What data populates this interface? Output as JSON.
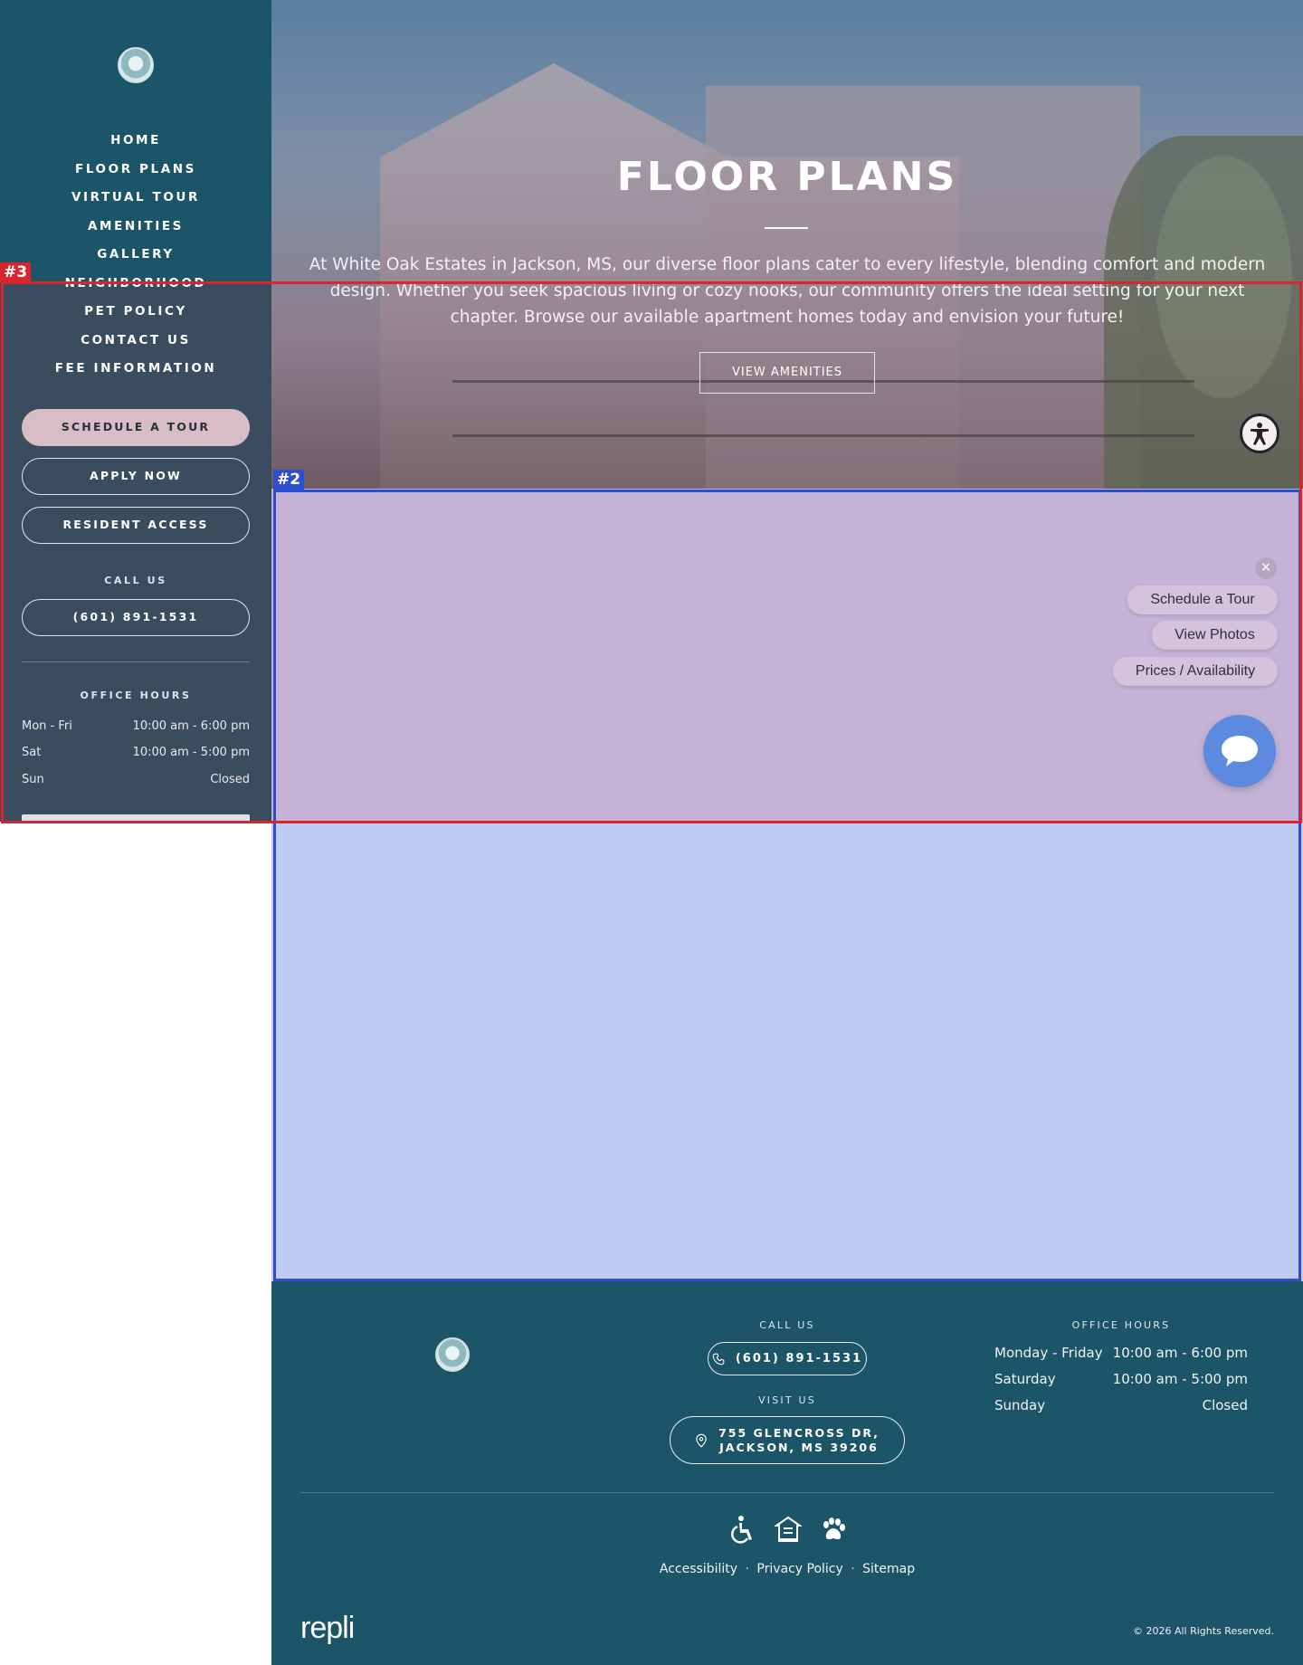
{
  "sidebar": {
    "nav": [
      "HOME",
      "FLOOR PLANS",
      "VIRTUAL TOUR",
      "AMENITIES",
      "GALLERY",
      "NEIGHBORHOOD",
      "PET POLICY",
      "CONTACT US",
      "FEE INFORMATION"
    ],
    "schedule_tour": "SCHEDULE A TOUR",
    "apply_now": "APPLY NOW",
    "resident_access": "RESIDENT ACCESS",
    "call_us_label": "CALL US",
    "phone": "(601) 891-1531",
    "office_hours_label": "OFFICE HOURS",
    "hours": [
      {
        "day": "Mon - Fri",
        "time": "10:00 am - 6:00 pm"
      },
      {
        "day": "Sat",
        "time": "10:00 am - 5:00 pm"
      },
      {
        "day": "Sun",
        "time": "Closed"
      }
    ]
  },
  "hero": {
    "title": "FLOOR PLANS",
    "description": "At White Oak Estates in Jackson, MS, our diverse floor plans cater to every lifestyle, blending comfort and modern design. Whether you seek spacious living or cozy nooks, our community offers the ideal setting for your next chapter. Browse our available apartment homes today and envision your future!",
    "cta": "VIEW AMENITIES"
  },
  "chat": {
    "close": "×",
    "options": [
      "Schedule a Tour",
      "View Photos",
      "Prices / Availability"
    ]
  },
  "footer": {
    "call_us_label": "CALL US",
    "phone": "(601) 891-1531",
    "visit_us_label": "VISIT US",
    "address_line1": "755 GLENCROSS DR,",
    "address_line2": "JACKSON, MS 39206",
    "office_hours_label": "OFFICE HOURS",
    "hours": [
      {
        "day": "Monday - Friday",
        "time": "10:00 am - 6:00 pm"
      },
      {
        "day": "Saturday",
        "time": "10:00 am - 5:00 pm"
      },
      {
        "day": "Sunday",
        "time": "Closed"
      }
    ],
    "links": [
      "Accessibility",
      "Privacy Policy",
      "Sitemap"
    ],
    "link_separator": "·",
    "brand": "repli",
    "copyright": "© 2026 All Rights Reserved."
  },
  "annotations": {
    "red_tag": "#3",
    "blue_tag": "#2",
    "red_color": "#d9262e",
    "blue_color": "#2c4fd0"
  },
  "icons": [
    "accessibility-icon",
    "phone-icon",
    "location-pin-icon",
    "wheelchair-icon",
    "equal-housing-icon",
    "paw-icon",
    "chat-icon",
    "close-icon"
  ]
}
